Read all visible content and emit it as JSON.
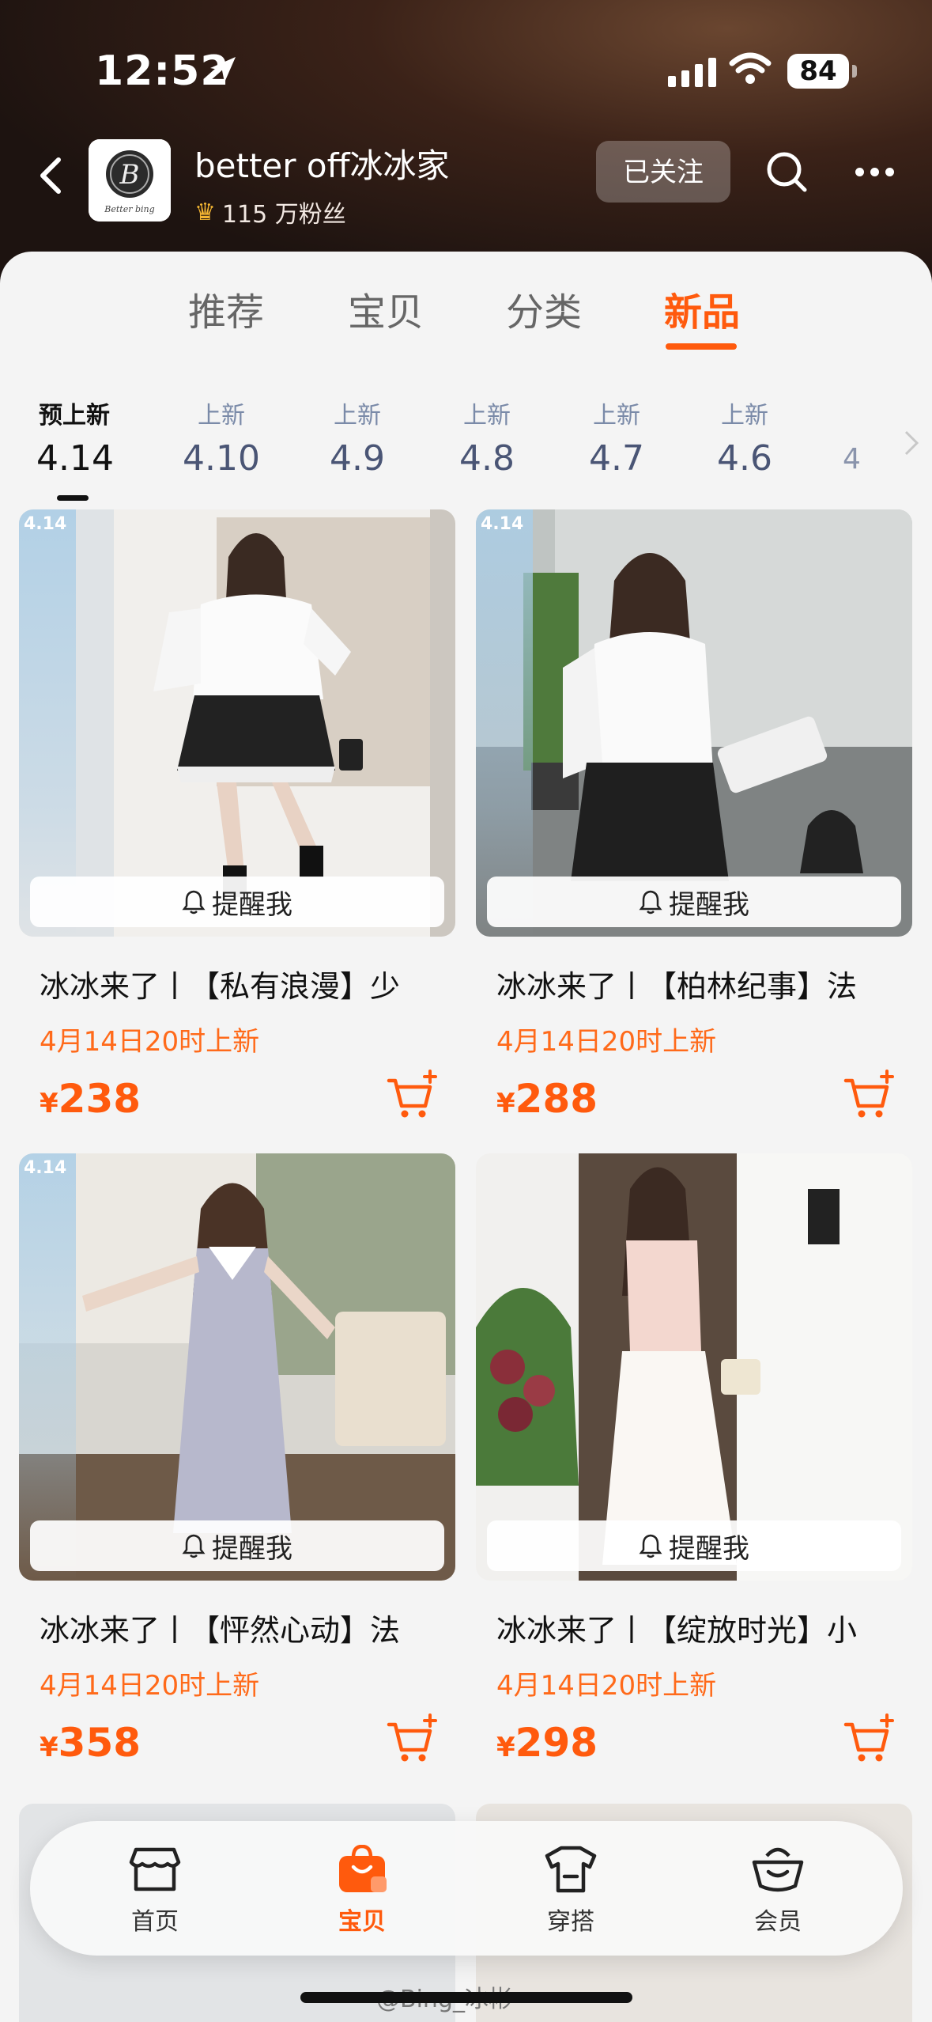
{
  "status_bar": {
    "time": "12:52",
    "battery": "84"
  },
  "shop": {
    "name": "better off冰冰家",
    "fans": "115 万粉丝",
    "follow_label": "已关注",
    "logo_text": "Better bing"
  },
  "tabs": [
    {
      "label": "推荐"
    },
    {
      "label": "宝贝"
    },
    {
      "label": "分类"
    },
    {
      "label": "新品"
    }
  ],
  "active_tab": "新品",
  "dates": [
    {
      "label": "预上新",
      "day": "4.14"
    },
    {
      "label": "上新",
      "day": "4.10"
    },
    {
      "label": "上新",
      "day": "4.9"
    },
    {
      "label": "上新",
      "day": "4.8"
    },
    {
      "label": "上新",
      "day": "4.7"
    },
    {
      "label": "上新",
      "day": "4.6"
    }
  ],
  "date_peek": "4",
  "products": [
    {
      "title": "冰冰来了丨【私有浪漫】少",
      "launch": "4月14日20时上新",
      "currency": "¥",
      "price": "238",
      "remind": "提醒我",
      "tag": "4.14"
    },
    {
      "title": "冰冰来了丨【柏林纪事】法",
      "launch": "4月14日20时上新",
      "currency": "¥",
      "price": "288",
      "remind": "提醒我",
      "tag": "4.14"
    },
    {
      "title": "冰冰来了丨【怦然心动】法",
      "launch": "4月14日20时上新",
      "currency": "¥",
      "price": "358",
      "remind": "提醒我",
      "tag": "4.14"
    },
    {
      "title": "冰冰来了丨【绽放时光】小",
      "launch": "4月14日20时上新",
      "currency": "¥",
      "price": "298",
      "remind": "提醒我",
      "tag": ""
    }
  ],
  "bottom_nav": [
    {
      "label": "首页"
    },
    {
      "label": "宝贝"
    },
    {
      "label": "穿搭"
    },
    {
      "label": "会员"
    }
  ],
  "watermark": "@Bing_冰彬",
  "colors": {
    "accent": "#ff5a0d",
    "header_bg": "#2a1a14"
  }
}
